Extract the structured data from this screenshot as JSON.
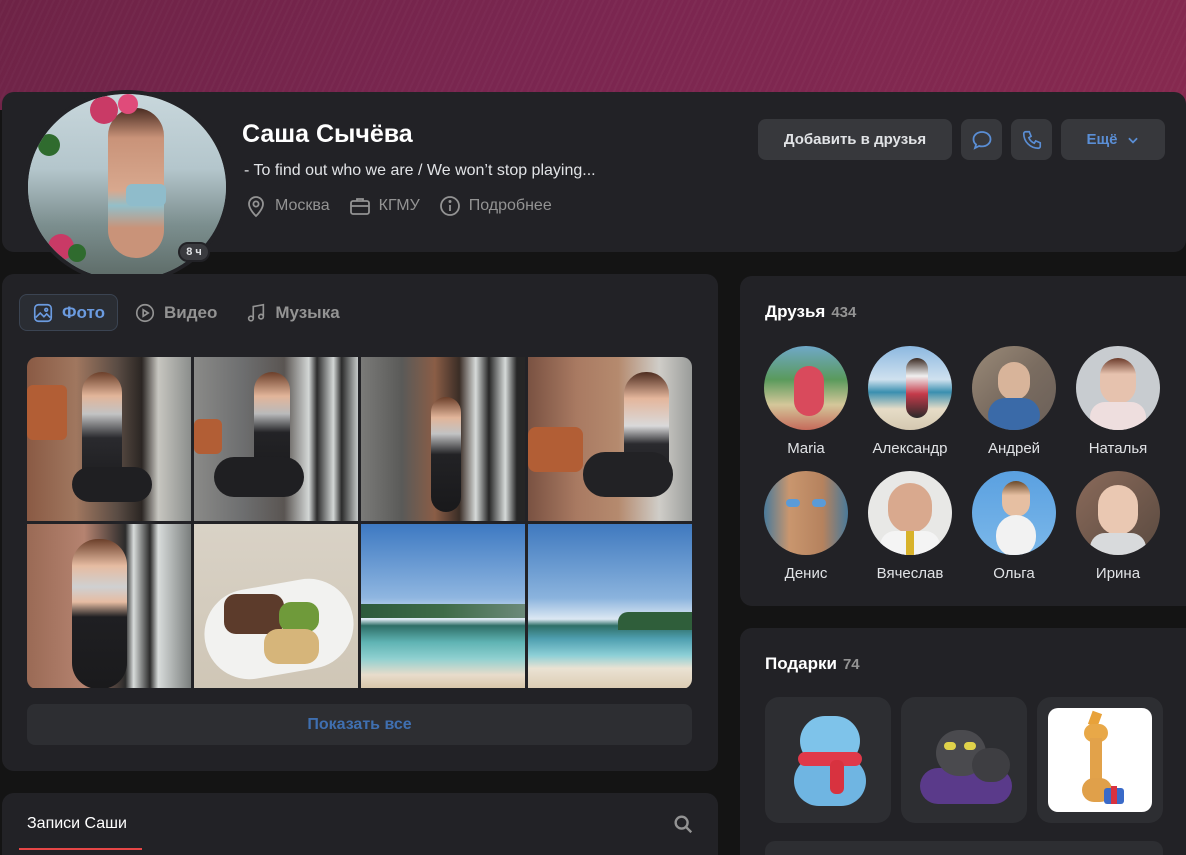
{
  "profile": {
    "name": "Саша Сычёва",
    "status": "- To find out who we are / We won’t stop playing...",
    "online_badge": "8 ч",
    "city": "Москва",
    "work": "КГМУ",
    "details_label": "Подробнее"
  },
  "actions": {
    "add_friend": "Добавить в друзья",
    "more": "Ещё",
    "message_icon": "chat-bubble-icon",
    "call_icon": "phone-icon"
  },
  "media": {
    "tabs": [
      {
        "label": "Фото",
        "icon": "photo-icon",
        "active": true
      },
      {
        "label": "Видео",
        "icon": "play-icon",
        "active": false
      },
      {
        "label": "Музыка",
        "icon": "music-note-icon",
        "active": false
      }
    ],
    "show_all": "Показать все"
  },
  "posts": {
    "title": "Записи Саши"
  },
  "friends": {
    "title": "Друзья",
    "count": "434",
    "items": [
      {
        "name": "Maria"
      },
      {
        "name": "Александр"
      },
      {
        "name": "Андрей"
      },
      {
        "name": "Наталья"
      },
      {
        "name": "Денис"
      },
      {
        "name": "Вячеслав"
      },
      {
        "name": "Ольга"
      },
      {
        "name": "Ирина"
      }
    ]
  },
  "gifts": {
    "title": "Подарки",
    "count": "74"
  },
  "colors": {
    "accent": "#5a8ed5",
    "card_bg": "#222226",
    "page_bg": "#141414",
    "cover": "#7a2650"
  }
}
